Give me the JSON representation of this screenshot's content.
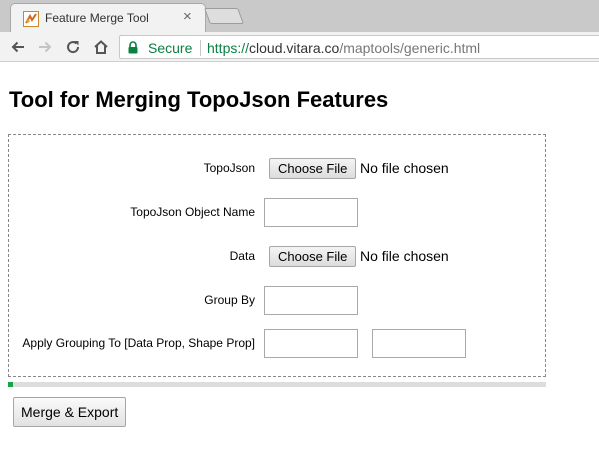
{
  "browser": {
    "tab": {
      "title": "Feature Merge Tool",
      "close_glyph": "×"
    },
    "omnibox": {
      "secure_label": "Secure",
      "url_scheme": "https://",
      "url_host": "cloud.vitara.co",
      "url_path": "/maptools/generic.html"
    },
    "colors": {
      "secure_green": "#0b8043"
    }
  },
  "page": {
    "title": "Tool for Merging TopoJson Features",
    "form": {
      "topojson": {
        "label": "TopoJson",
        "button_label": "Choose File",
        "status": "No file chosen"
      },
      "object_name": {
        "label": "TopoJson Object Name",
        "value": ""
      },
      "data": {
        "label": "Data",
        "button_label": "Choose File",
        "status": "No file chosen"
      },
      "group_by": {
        "label": "Group By",
        "value": ""
      },
      "apply_grouping": {
        "label": "Apply Grouping To [Data Prop, Shape Prop]",
        "data_prop_value": "",
        "shape_prop_value": ""
      }
    },
    "progress": {
      "fraction": 0.01,
      "color": "#19a44a"
    },
    "merge_button_label": "Merge & Export"
  }
}
